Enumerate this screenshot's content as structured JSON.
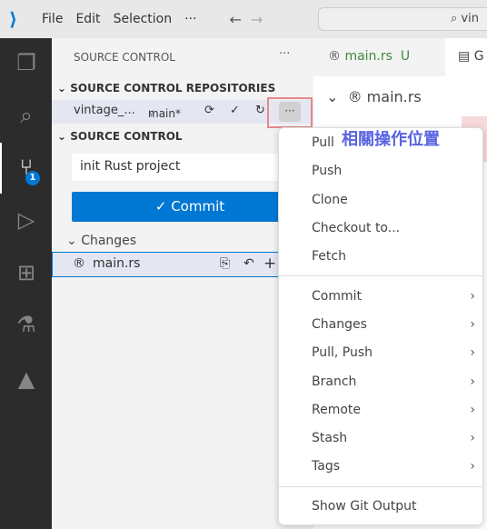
{
  "titlebar": {
    "menus": [
      "File",
      "Edit",
      "Selection",
      "···"
    ],
    "search_text": "vin"
  },
  "activity": {
    "items": [
      "explorer-icon",
      "search-icon",
      "source-control-icon",
      "run-debug-icon",
      "extensions-icon",
      "testing-icon",
      "azure-icon"
    ],
    "badge": "1"
  },
  "sidebar": {
    "title": "SOURCE CONTROL",
    "more": "···",
    "repos_header": "SOURCE CONTROL REPOSITORIES",
    "repo": {
      "name": "vintage_...",
      "branch": "main*"
    },
    "sc_header": "SOURCE CONTROL",
    "commit_message": "init Rust project",
    "commit_label": "✓ Commit",
    "changes_label": "Changes",
    "file": "main.rs"
  },
  "editor": {
    "tab1": "main.rs",
    "tab1_status": "U",
    "tab2": "G",
    "breadcrumb": "main.rs"
  },
  "annotation": "相關操作位置",
  "context_menu": {
    "group1": [
      "Pull",
      "Push",
      "Clone",
      "Checkout to...",
      "Fetch"
    ],
    "group2": [
      "Commit",
      "Changes",
      "Pull, Push",
      "Branch",
      "Remote",
      "Stash",
      "Tags"
    ],
    "group3": [
      "Show Git Output"
    ]
  },
  "colors": {
    "accent": "#0078d4",
    "annotation": "#5a63e0",
    "highlight": "#e8888a"
  }
}
